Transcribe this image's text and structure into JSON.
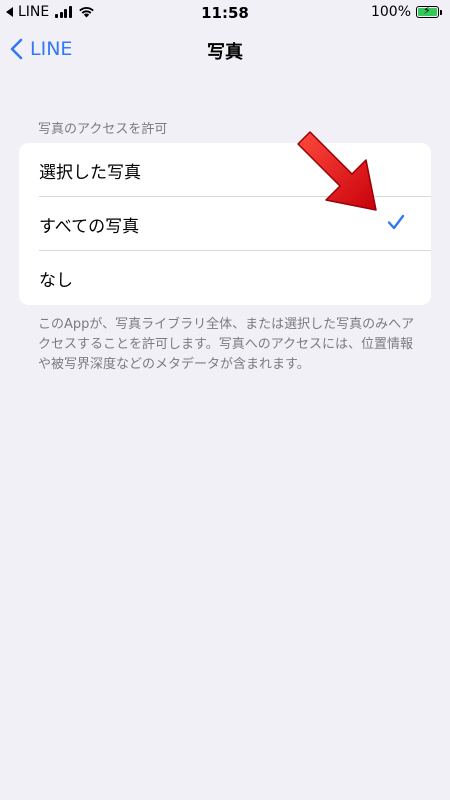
{
  "status_bar": {
    "back_app": "LINE",
    "time": "11:58",
    "battery": "100%"
  },
  "nav": {
    "back_label": "LINE",
    "title": "写真"
  },
  "section": {
    "header": "写真のアクセスを許可",
    "options": [
      {
        "label": "選択した写真",
        "selected": false
      },
      {
        "label": "すべての写真",
        "selected": true
      },
      {
        "label": "なし",
        "selected": false
      }
    ],
    "footer": "このAppが、写真ライブラリ全体、または選択した写真のみへアクセスすることを許可します。写真へのアクセスには、位置情報や被写界深度などのメタデータが含まれます。"
  },
  "colors": {
    "accent": "#3478f6",
    "background": "#f1f0f6",
    "annotation_arrow": "#e8141c"
  }
}
